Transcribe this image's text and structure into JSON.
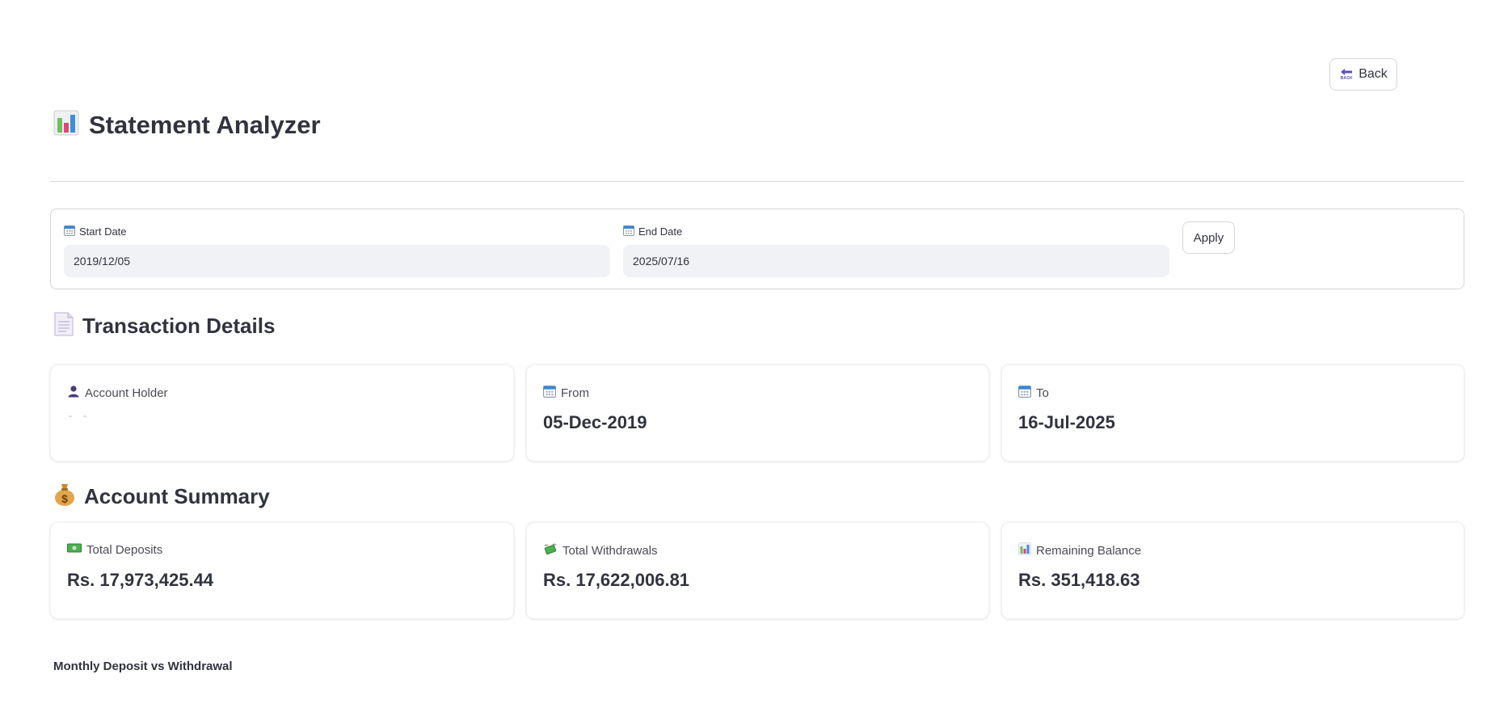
{
  "header": {
    "back_label": "Back",
    "back_icon": "back-arrow-icon",
    "back_icon_text": "BACK",
    "title": "Statement Analyzer",
    "title_icon": "bar-chart-icon"
  },
  "date_filter": {
    "start_label": "Start Date",
    "start_value": "2019/12/05",
    "end_label": "End Date",
    "end_value": "2025/07/16",
    "apply_label": "Apply",
    "field_icon": "calendar-icon"
  },
  "transaction_details": {
    "title": "Transaction Details",
    "title_icon": "document-icon",
    "cards": [
      {
        "label": "Account Holder",
        "icon": "person-icon",
        "value": ""
      },
      {
        "label": "From",
        "icon": "calendar-icon",
        "value": "05-Dec-2019"
      },
      {
        "label": "To",
        "icon": "calendar-icon",
        "value": "16-Jul-2025"
      }
    ]
  },
  "account_summary": {
    "title": "Account Summary",
    "title_icon": "money-bag-icon",
    "cards": [
      {
        "label": "Total Deposits",
        "icon": "banknote-icon",
        "value": "Rs. 17,973,425.44"
      },
      {
        "label": "Total Withdrawals",
        "icon": "money-with-wings-icon",
        "value": "Rs. 17,622,006.81"
      },
      {
        "label": "Remaining Balance",
        "icon": "bar-chart-icon",
        "value": "Rs. 351,418.63"
      }
    ]
  },
  "chart": {
    "caption": "Monthly Deposit vs Withdrawal"
  },
  "colors": {
    "text": "#31333f",
    "input_bg": "#f0f2f6",
    "border": "#d6d6d9",
    "accent_purple": "#5b4fb8"
  }
}
